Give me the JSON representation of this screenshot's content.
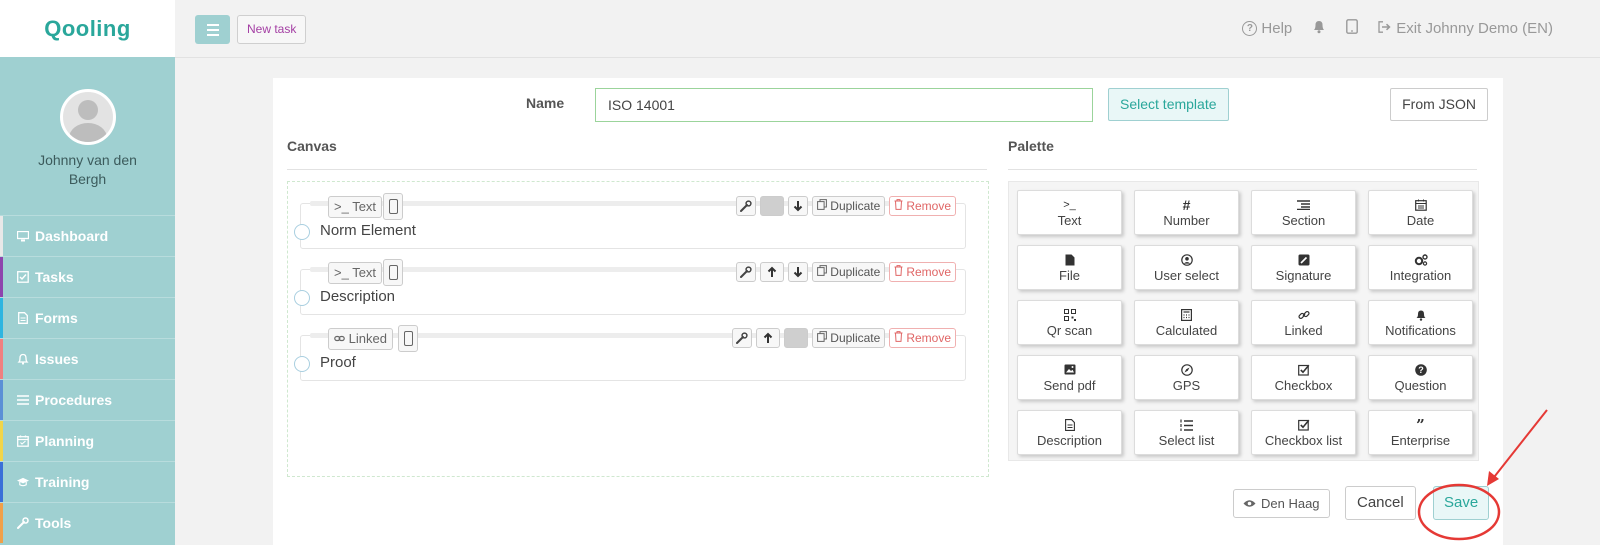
{
  "app": {
    "logo": "Qooling",
    "user_name": "Johnny van den Bergh"
  },
  "topbar": {
    "new_task_label": "New task",
    "help_label": "Help",
    "exit_label": "Exit Johnny Demo (EN)"
  },
  "sidebar": {
    "items": [
      {
        "label": "Dashboard",
        "icon": "monitor-icon",
        "color": "#e8e8e8"
      },
      {
        "label": "Tasks",
        "icon": "checkbox-icon",
        "color": "#8e44ad"
      },
      {
        "label": "Forms",
        "icon": "document-icon",
        "color": "#2eb5e0"
      },
      {
        "label": "Issues",
        "icon": "bell-icon",
        "color": "#f08080"
      },
      {
        "label": "Procedures",
        "icon": "list-icon",
        "color": "#5b8fd6"
      },
      {
        "label": "Planning",
        "icon": "calendar-icon",
        "color": "#f1d54a"
      },
      {
        "label": "Training",
        "icon": "graduation-cap-icon",
        "color": "#3a6fd8"
      },
      {
        "label": "Tools",
        "icon": "wrench-icon",
        "color": "#f0a04a"
      }
    ]
  },
  "form": {
    "name_label": "Name",
    "name_value": "ISO 14001",
    "select_template_label": "Select template",
    "from_json_label": "From JSON"
  },
  "canvas": {
    "title": "Canvas",
    "rows": [
      {
        "type": "Text",
        "label": "Norm Element",
        "duplicate": "Duplicate",
        "remove": "Remove"
      },
      {
        "type": "Text",
        "label": "Description",
        "duplicate": "Duplicate",
        "remove": "Remove"
      },
      {
        "type": "Linked",
        "label": "Proof",
        "duplicate": "Duplicate",
        "remove": "Remove"
      }
    ]
  },
  "palette": {
    "title": "Palette",
    "items": [
      {
        "label": "Text",
        "icon": "terminal-icon"
      },
      {
        "label": "Number",
        "icon": "hash-icon"
      },
      {
        "label": "Section",
        "icon": "section-icon"
      },
      {
        "label": "Date",
        "icon": "calendar-icon"
      },
      {
        "label": "File",
        "icon": "file-icon"
      },
      {
        "label": "User select",
        "icon": "user-circle-icon"
      },
      {
        "label": "Signature",
        "icon": "signature-icon"
      },
      {
        "label": "Integration",
        "icon": "cogs-icon"
      },
      {
        "label": "Qr scan",
        "icon": "qr-code-icon"
      },
      {
        "label": "Calculated",
        "icon": "calculator-icon"
      },
      {
        "label": "Linked",
        "icon": "link-icon"
      },
      {
        "label": "Notifications",
        "icon": "bell-icon"
      },
      {
        "label": "Send pdf",
        "icon": "image-icon"
      },
      {
        "label": "GPS",
        "icon": "compass-icon"
      },
      {
        "label": "Checkbox",
        "icon": "checkbox-icon"
      },
      {
        "label": "Question",
        "icon": "question-icon"
      },
      {
        "label": "Description",
        "icon": "document-icon"
      },
      {
        "label": "Select list",
        "icon": "list-icon"
      },
      {
        "label": "Checkbox list",
        "icon": "checkbox-icon"
      },
      {
        "label": "Enterprise",
        "icon": "quote-icon"
      }
    ]
  },
  "footer": {
    "location_label": "Den Haag",
    "cancel_label": "Cancel",
    "save_label": "Save"
  },
  "colors": {
    "accent": "#2aa79b",
    "sidebar_bg": "#9fd0d1",
    "annotation": "#e53935"
  }
}
